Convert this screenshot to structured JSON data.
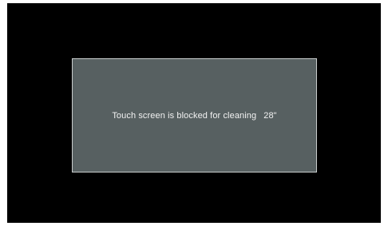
{
  "dialog": {
    "message": "Touch screen is blocked for cleaning",
    "countdown": "28\""
  },
  "colors": {
    "screen_background": "#000000",
    "dialog_background": "#576061",
    "dialog_border": "#c9cdcd",
    "text": "#f2f2f2"
  }
}
